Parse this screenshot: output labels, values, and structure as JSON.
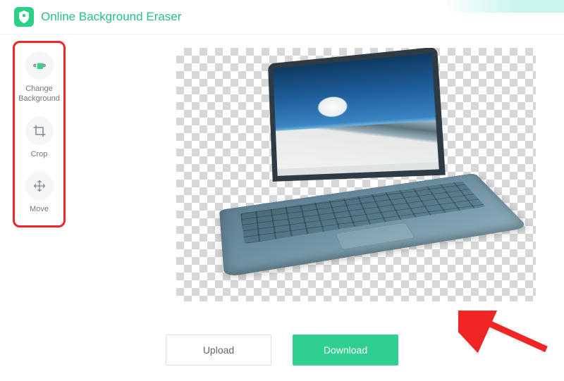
{
  "header": {
    "app_title": "Online Background Eraser"
  },
  "sidebar": {
    "tools": [
      {
        "label": "Change\nBackground",
        "icon": "change-background-icon"
      },
      {
        "label": "Crop",
        "icon": "crop-icon"
      },
      {
        "label": "Move",
        "icon": "move-icon"
      }
    ]
  },
  "footer": {
    "upload_label": "Upload",
    "download_label": "Download"
  },
  "colors": {
    "accent": "#2ecf87",
    "highlight": "#f02626"
  }
}
